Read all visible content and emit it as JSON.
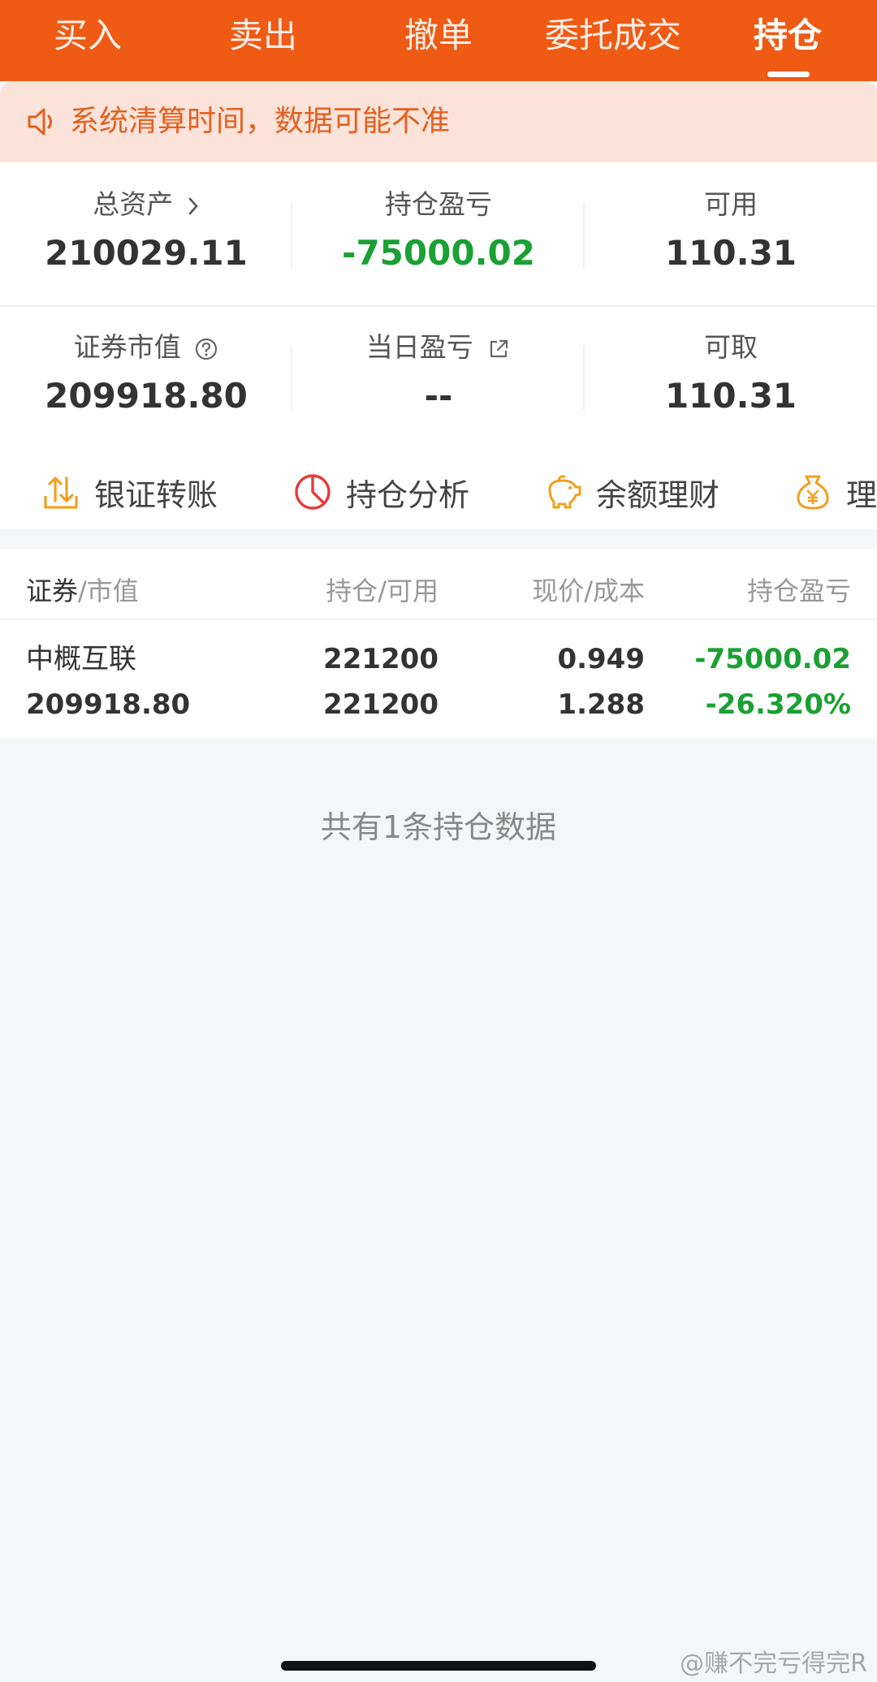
{
  "tabs": [
    {
      "label": "买入"
    },
    {
      "label": "卖出"
    },
    {
      "label": "撤单"
    },
    {
      "label": "委托成交"
    },
    {
      "label": "持仓",
      "active": true
    }
  ],
  "notice": {
    "text": "系统清算时间，数据可能不准",
    "icon": "speaker-icon"
  },
  "summary": {
    "total_assets": {
      "label": "总资产",
      "value": "210029.11",
      "icon": "chevron-right-icon"
    },
    "position_pl": {
      "label": "持仓盈亏",
      "value": "-75000.02"
    },
    "available": {
      "label": "可用",
      "value": "110.31"
    },
    "market_value": {
      "label": "证券市值",
      "value": "209918.80",
      "icon": "help-circle-icon"
    },
    "daily_pl": {
      "label": "当日盈亏",
      "value": "--",
      "icon": "external-link-icon"
    },
    "withdrawable": {
      "label": "可取",
      "value": "110.31"
    }
  },
  "shortcuts": [
    {
      "label": "银证转账",
      "icon": "transfer-icon"
    },
    {
      "label": "持仓分析",
      "icon": "pie-chart-icon"
    },
    {
      "label": "余额理财",
      "icon": "piggy-bank-icon"
    },
    {
      "label": "理财",
      "icon": "money-bag-icon"
    }
  ],
  "table": {
    "headers": {
      "security": "证券",
      "security_sub": "/市值",
      "position": "持仓/可用",
      "price": "现价/成本",
      "pl": "持仓盈亏"
    },
    "rows": [
      {
        "name": "中概互联",
        "market_value": "209918.80",
        "holding": "221200",
        "available": "221200",
        "price": "0.949",
        "cost": "1.288",
        "pl": "-75000.02",
        "pl_pct": "-26.320%"
      }
    ]
  },
  "footer": {
    "text": "共有1条持仓数据"
  },
  "watermark": {
    "text": "@赚不完亏得完R"
  },
  "colors": {
    "brand": "#ef5a14",
    "loss": "#1aa033",
    "notice_bg": "#fbe3da"
  }
}
